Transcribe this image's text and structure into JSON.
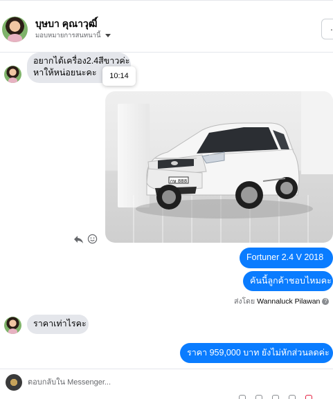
{
  "header": {
    "contact_name": "บุษบา คุณาวุฒิ์",
    "assignment": "มอบหมายการสนทนานี้",
    "more_button_label": "·"
  },
  "messages": {
    "incoming_1_line1": "อยากได้เครื่อง2.4สีขาวค่ะ",
    "incoming_1_line2": "หาให้หน่อยนะคะ",
    "timestamp_tooltip": "10:14",
    "outgoing_1": "Fortuner 2.4 V   2018",
    "outgoing_2": "คันนี้ลูกค้าชอบไหมคะ",
    "sent_by_prefix": "ส่งโดย",
    "sent_by_name": "Wannaluck Pilawan",
    "incoming_2": "ราคาเท่าไรคะ",
    "outgoing_3": "ราคา 959,000 บาท  ยังไม่หักส่วนลดค่ะ"
  },
  "photo": {
    "plate_text": "กษ 888"
  },
  "composer": {
    "placeholder": "ตอบกลับใน Messenger..."
  },
  "icons": {
    "reply": "reply-icon",
    "react": "smiley-icon",
    "info": "info-icon",
    "caret": "chevron-down-icon"
  },
  "colors": {
    "outgoing_bubble": "#0a7cff",
    "incoming_bubble": "#e4e6eb",
    "secondary_text": "#65676b"
  }
}
